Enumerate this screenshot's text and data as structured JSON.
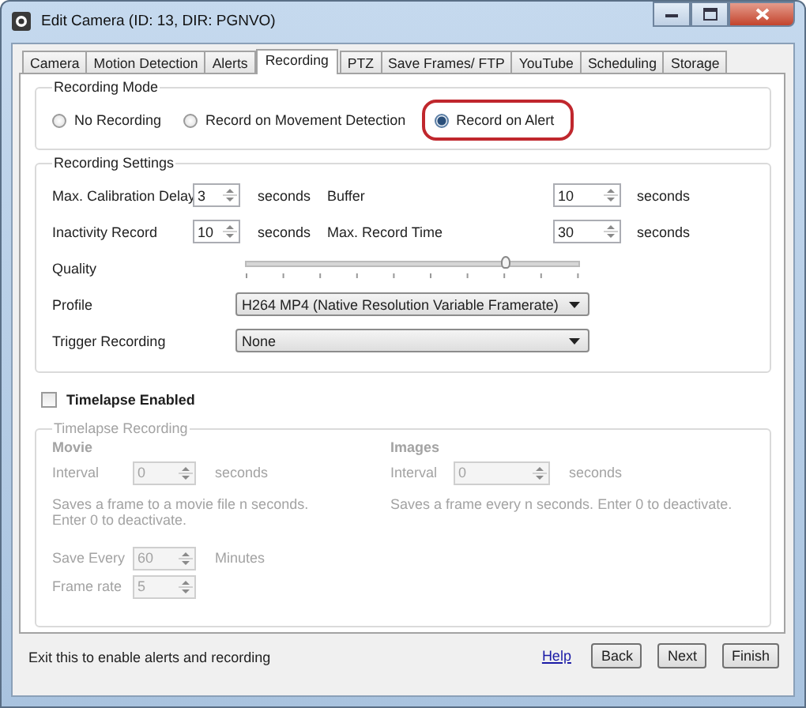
{
  "window": {
    "title": "Edit Camera (ID: 13, DIR: PGNVO)"
  },
  "tabs": [
    {
      "label": "Camera",
      "selected": false
    },
    {
      "label": "Motion Detection",
      "selected": false
    },
    {
      "label": "Alerts",
      "selected": false
    },
    {
      "label": "Recording",
      "selected": true
    },
    {
      "label": "PTZ",
      "selected": false
    },
    {
      "label": "Save Frames/ FTP",
      "selected": false
    },
    {
      "label": "YouTube",
      "selected": false
    },
    {
      "label": "Scheduling",
      "selected": false
    },
    {
      "label": "Storage",
      "selected": false
    }
  ],
  "recording_mode": {
    "title": "Recording Mode",
    "options": [
      {
        "label": "No Recording",
        "selected": false,
        "highlighted": false
      },
      {
        "label": "Record on Movement Detection",
        "selected": false,
        "highlighted": false
      },
      {
        "label": "Record on Alert",
        "selected": true,
        "highlighted": true
      }
    ]
  },
  "recording_settings": {
    "title": "Recording Settings",
    "rows": [
      {
        "kind": "spinners",
        "fields": [
          {
            "label": "Max. Calibration Delay",
            "value": "3",
            "unit": "seconds"
          },
          {
            "label": "Buffer",
            "value": "10",
            "unit": "seconds"
          }
        ]
      },
      {
        "kind": "spinners",
        "fields": [
          {
            "label": "Inactivity Record",
            "value": "10",
            "unit": "seconds"
          },
          {
            "label": "Max. Record Time",
            "value": "30",
            "unit": "seconds"
          }
        ]
      },
      {
        "kind": "slider",
        "label": "Quality",
        "level": 0.78
      },
      {
        "kind": "dropdown",
        "label": "Profile",
        "value": "H264 MP4 (Native Resolution Variable Framerate)"
      },
      {
        "kind": "dropdown",
        "label": "Trigger Recording",
        "value": "None"
      }
    ]
  },
  "timelapse": {
    "checkbox": {
      "label": "Timelapse Enabled",
      "checked": false
    },
    "group": {
      "title": "Timelapse Recording",
      "disabled": true,
      "columns": [
        {
          "items": [
            {
              "kind": "heading",
              "text": "Movie"
            },
            {
              "kind": "spinner",
              "label": "Interval",
              "value": "0",
              "unit": "seconds"
            },
            {
              "kind": "note",
              "text": "Saves a frame to a movie file n seconds. Enter 0 to deactivate."
            },
            {
              "kind": "spinner",
              "label": "Save Every",
              "value": "60",
              "unit": "Minutes"
            },
            {
              "kind": "spinner",
              "label": "Frame rate",
              "value": "5"
            }
          ]
        },
        {
          "items": [
            {
              "kind": "heading",
              "text": "Images"
            },
            {
              "kind": "spinner",
              "label": "Interval",
              "value": "0",
              "unit": "seconds"
            },
            {
              "kind": "note",
              "text": "Saves a frame every n seconds. Enter 0 to deactivate."
            }
          ]
        }
      ]
    }
  },
  "footer": {
    "status": "Exit this to enable alerts and recording",
    "help": "Help",
    "buttons": [
      "Back",
      "Next",
      "Finish"
    ]
  }
}
